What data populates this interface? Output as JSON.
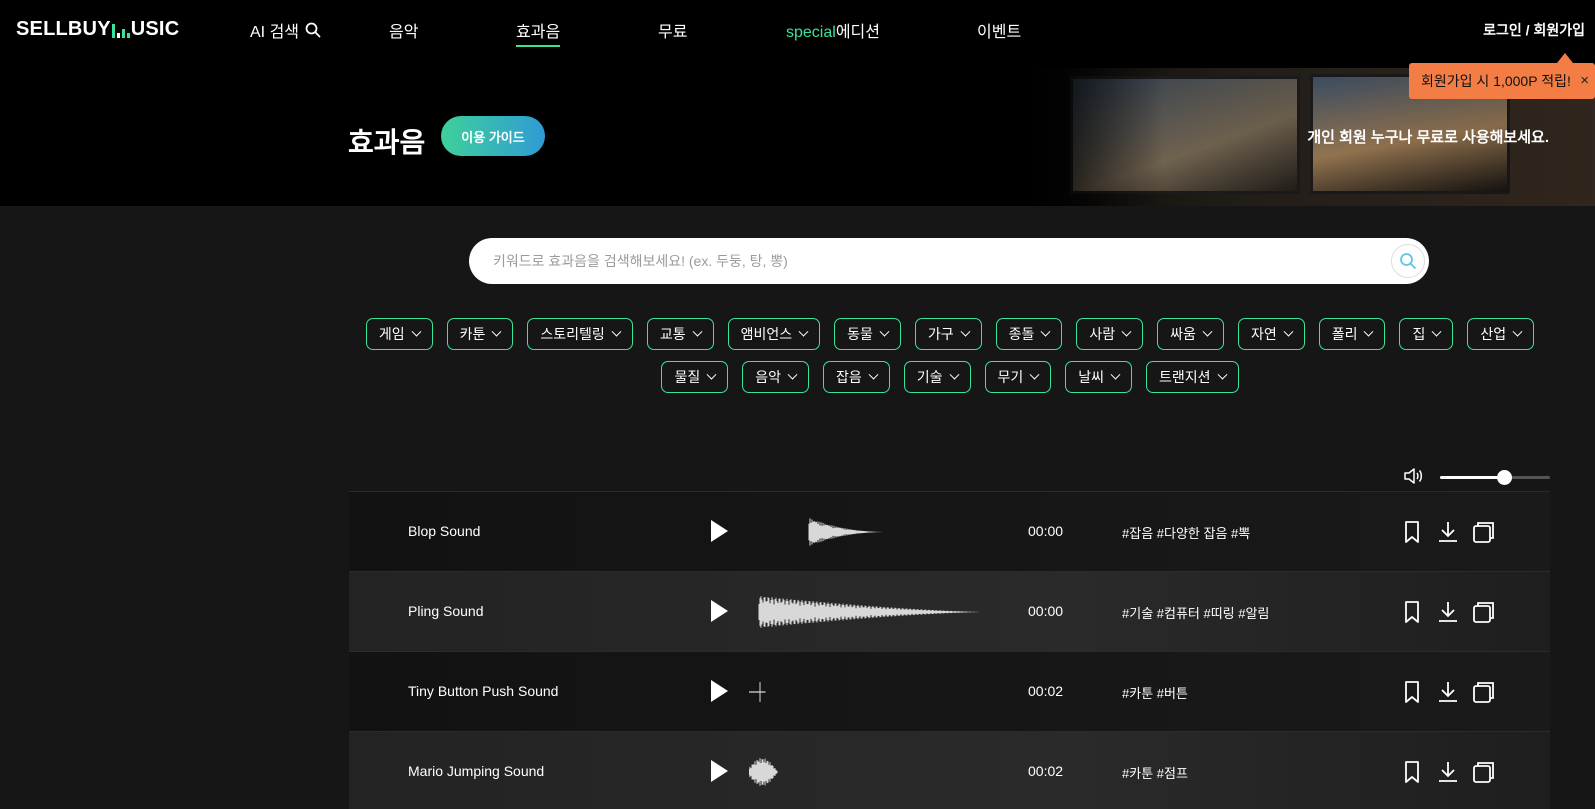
{
  "nav": {
    "logo": "SELLBUY USIC",
    "items": [
      "AI 검색",
      "음악",
      "효과음",
      "무료",
      "special",
      "에디션",
      "이벤트"
    ],
    "ai_search": "AI 검색",
    "music": "음악",
    "sfx": "효과음",
    "free": "무료",
    "special_green": "special",
    "special_white": "에디션",
    "event": "이벤트",
    "auth": "로그인 / 회원가입"
  },
  "promo": {
    "text": "회원가입 시 1,000P 적립!",
    "close": "×"
  },
  "hero": {
    "title": "효과음",
    "guide_button": "이용 가이드",
    "tagline": "개인 회원 누구나 무료로 사용해보세요."
  },
  "search": {
    "placeholder": "키워드로 효과음을 검색해보세요! (ex. 두둥, 탕, 뽕)",
    "value": ""
  },
  "categories": [
    "게임",
    "카툰",
    "스토리텔링",
    "교통",
    "앰비언스",
    "동물",
    "가구",
    "종돌",
    "사람",
    "싸움",
    "자연",
    "폴리",
    "집",
    "산업",
    "물질",
    "음악",
    "잡음",
    "기술",
    "무기",
    "날씨",
    "트랜지션"
  ],
  "volume": {
    "level": 0.5
  },
  "tracks": [
    {
      "title": "Blop Sound",
      "duration": "00:00",
      "tags": "#잡음 #다양한 잡음 #뽁"
    },
    {
      "title": "Pling Sound",
      "duration": "00:00",
      "tags": "#기술 #컴퓨터 #띠링 #알림"
    },
    {
      "title": "Tiny Button Push Sound",
      "duration": "00:02",
      "tags": "#카툰 #버튼"
    },
    {
      "title": "Mario Jumping Sound",
      "duration": "00:02",
      "tags": "#카툰 #점프"
    }
  ],
  "colors": {
    "accent": "#3be39a",
    "promo": "#f47d45",
    "guide_from": "#3fd09a",
    "guide_to": "#2f9bd6"
  },
  "icons": [
    "search-icon",
    "chevron-down-icon",
    "speaker-icon",
    "play-icon",
    "bookmark-icon",
    "download-icon",
    "copy-icon",
    "close-icon"
  ]
}
